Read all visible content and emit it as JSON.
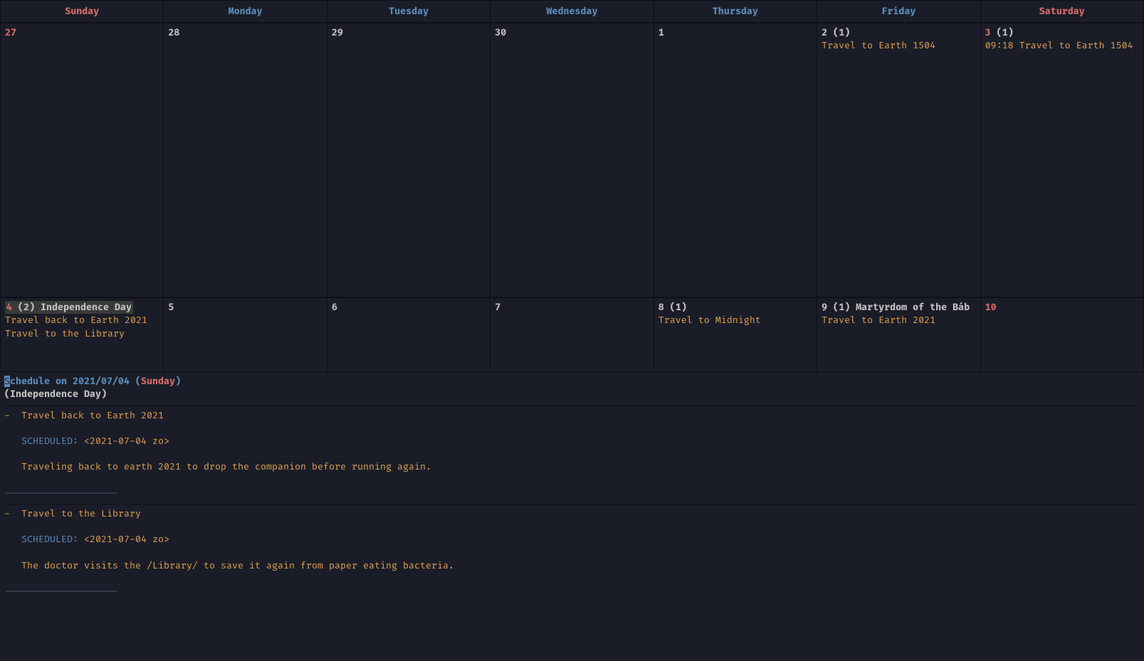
{
  "headers": [
    "Sunday",
    "Monday",
    "Tuesday",
    "Wednesday",
    "Thursday",
    "Friday",
    "Saturday"
  ],
  "row1": [
    {
      "num": "27",
      "weekend": true,
      "count": "",
      "holiday": "",
      "holiday_bg": false,
      "events": []
    },
    {
      "num": "28",
      "weekend": false,
      "count": "",
      "holiday": "",
      "holiday_bg": false,
      "events": []
    },
    {
      "num": "29",
      "weekend": false,
      "count": "",
      "holiday": "",
      "holiday_bg": false,
      "events": []
    },
    {
      "num": "30",
      "weekend": false,
      "count": "",
      "holiday": "",
      "holiday_bg": false,
      "events": []
    },
    {
      "num": "1",
      "weekend": false,
      "count": "",
      "holiday": "",
      "holiday_bg": false,
      "events": []
    },
    {
      "num": "2",
      "weekend": false,
      "count": "(1)",
      "holiday": "",
      "holiday_bg": false,
      "events": [
        "Travel to Earth 1504"
      ]
    },
    {
      "num": "3",
      "weekend": true,
      "count": "(1)",
      "holiday": "",
      "holiday_bg": false,
      "events": [
        "09:18 Travel to Earth 1504"
      ]
    }
  ],
  "row2": [
    {
      "num": "4",
      "weekend": true,
      "count": "(2)",
      "holiday": "Independence Day",
      "holiday_bg": true,
      "events": [
        "Travel back to Earth 2021",
        "Travel to the Library"
      ]
    },
    {
      "num": "5",
      "weekend": false,
      "count": "",
      "holiday": "",
      "holiday_bg": false,
      "events": []
    },
    {
      "num": "6",
      "weekend": false,
      "count": "",
      "holiday": "",
      "holiday_bg": false,
      "events": []
    },
    {
      "num": "7",
      "weekend": false,
      "count": "",
      "holiday": "",
      "holiday_bg": false,
      "events": []
    },
    {
      "num": "8",
      "weekend": false,
      "count": "(1)",
      "holiday": "",
      "holiday_bg": false,
      "events": [
        "Travel to Midnight"
      ]
    },
    {
      "num": "9",
      "weekend": false,
      "count": "(1)",
      "holiday": "Martyrdom of the Báb",
      "holiday_bg": false,
      "events": [
        "Travel to Earth 2021"
      ]
    },
    {
      "num": "10",
      "weekend": true,
      "count": "",
      "holiday": "",
      "holiday_bg": false,
      "events": []
    }
  ],
  "schedule": {
    "title_prefix": "chedule on 2021/07/04 (",
    "title_cursor": "S",
    "title_day": "Sunday",
    "title_suffix": ")",
    "holiday": "(Independence Day)",
    "items": [
      {
        "bullet": "-  ",
        "title": "Travel back to Earth 2021",
        "sched_label": "SCHEDULED:",
        "sched_value": " <2021-07-04 zo>",
        "desc": "   Traveling back to earth 2021 to drop the companion before running again.",
        "sep": "--------------------"
      },
      {
        "bullet": "-  ",
        "title": "Travel to the Library",
        "sched_label": "SCHEDULED:",
        "sched_value": " <2021-07-04 zo>",
        "desc": "   The doctor visits the /Library/ to save it again from paper eating bacteria.",
        "sep": "--------------------"
      }
    ]
  }
}
